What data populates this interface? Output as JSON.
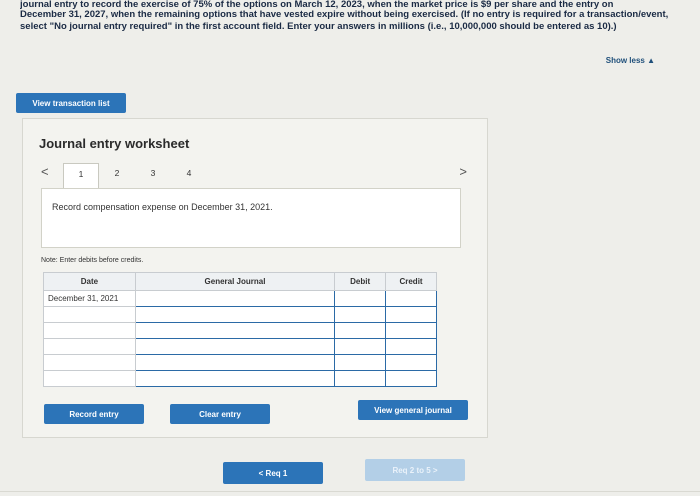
{
  "instructions": {
    "line_cut": "journal entry to record the exercise of 75% of the options on March 12, 2023, when the market price is $9 per share and the entry on",
    "text": "December 31, 2027, when the remaining options that have vested expire without being exercised. (If no entry is required for a transaction/event, select \"No journal entry required\" in the first account field. Enter your answers in millions (i.e., 10,000,000 should be entered as 10).)"
  },
  "show_less": "Show less ▲",
  "view_transaction_list": "View transaction list",
  "worksheet": {
    "title": "Journal entry worksheet",
    "prev": "<",
    "next": ">",
    "steps": [
      "1",
      "2",
      "3",
      "4"
    ],
    "active_step": 0,
    "prompt": "Record compensation expense on December 31, 2021.",
    "note": "Note: Enter debits before credits.",
    "table": {
      "headers": {
        "date": "Date",
        "journal": "General Journal",
        "debit": "Debit",
        "credit": "Credit"
      },
      "first_date": "December 31, 2021"
    }
  },
  "buttons": {
    "record": "Record entry",
    "clear": "Clear entry",
    "view_general_journal": "View general journal",
    "req_prev": "< Req 1",
    "req_next": "Req 2 to 5 >"
  },
  "colors": {
    "primary": "#2c74b8",
    "disabled": "#b3cfe7"
  }
}
